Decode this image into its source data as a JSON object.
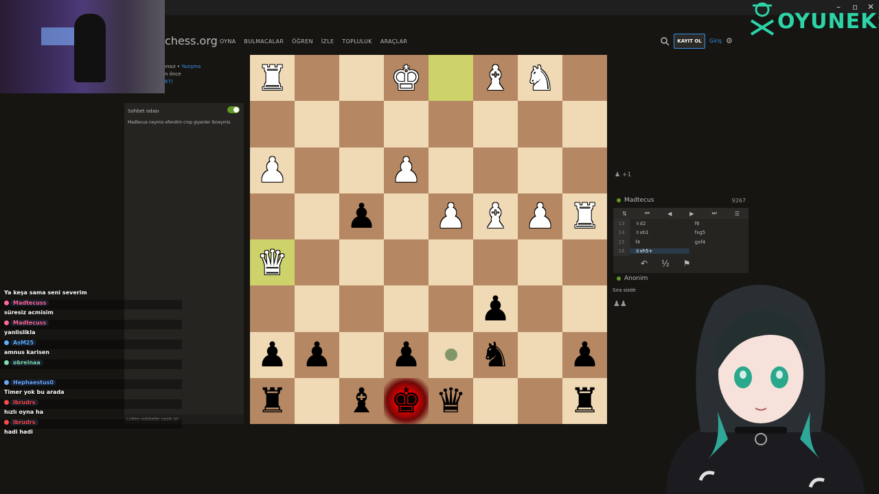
{
  "window": {
    "minimize": "–",
    "maximize": "▫",
    "close": "✕"
  },
  "brand": {
    "text": "OYUNEKS"
  },
  "site": {
    "logo": "chess.org",
    "nav": [
      "OYNA",
      "BULMACALAR",
      "ÖĞREN",
      "İZLE",
      "TOPLULUK",
      "ARAÇLAR"
    ],
    "signup": "KAYIT OL",
    "login": "Giriş"
  },
  "game_info": {
    "line1_prefix": "ınsız • ",
    "line1_link": "Yazışma",
    "line2": "n önce",
    "line3": "67)"
  },
  "chat": {
    "title": "Sohbet odası",
    "message": "Madtecus  neymis efendim crop giyenler ibneymis",
    "placeholder": "Lütfen sohbette nazik ol!"
  },
  "stream_chat": [
    {
      "kind": "text",
      "text": "Ya keşa sama seni severim"
    },
    {
      "kind": "name",
      "text": "Madtecuss",
      "color": "#ff6a9a"
    },
    {
      "kind": "text",
      "text": "süresiz acmisim"
    },
    {
      "kind": "name",
      "text": "Madtecuss",
      "color": "#ff6a9a"
    },
    {
      "kind": "text",
      "text": "yanlislikla"
    },
    {
      "kind": "name",
      "text": "AsM25",
      "color": "#5ab0ff"
    },
    {
      "kind": "text",
      "text": "amnus karisen"
    },
    {
      "kind": "name",
      "text": "obreinaa",
      "color": "#7ee0b0"
    },
    {
      "kind": "text",
      "text": ""
    },
    {
      "kind": "name",
      "text": "Hephaestus0",
      "color": "#6aa8ff"
    },
    {
      "kind": "text",
      "text": "Timer yok bu arada"
    },
    {
      "kind": "name",
      "text": "ibrudrs",
      "color": "#ff4a4a"
    },
    {
      "kind": "text",
      "text": "hızlı oyna ha"
    },
    {
      "kind": "name",
      "text": "ibrudrs",
      "color": "#ff4a4a"
    },
    {
      "kind": "text",
      "text": "hadi hadi"
    }
  ],
  "board": {
    "rows": [
      [
        "wR",
        "",
        "",
        "wK",
        "H",
        "wB",
        "wN",
        ""
      ],
      [
        "",
        "",
        "",
        "",
        "",
        "",
        "",
        ""
      ],
      [
        "wP",
        "",
        "",
        "wP",
        "",
        "",
        "",
        ""
      ],
      [
        "",
        "",
        "bP",
        "",
        "wP",
        "wB",
        "wP",
        "wR"
      ],
      [
        "wQH",
        "",
        "",
        "",
        "",
        "",
        "",
        ""
      ],
      [
        "",
        "",
        "",
        "",
        "",
        "bP",
        "",
        ""
      ],
      [
        "bP",
        "bP",
        "",
        "bP",
        "dot",
        "bN",
        "",
        "bP"
      ],
      [
        "bR",
        "",
        "bB",
        "bKC",
        "bQ",
        "",
        "",
        "bR"
      ]
    ]
  },
  "players": {
    "top": {
      "name": "Madtecus",
      "rating": "9267"
    },
    "bottom": {
      "name": "Anonim"
    }
  },
  "captured_top": "+1",
  "moves": [
    {
      "num": "13",
      "white": "♗d2",
      "black": "f6"
    },
    {
      "num": "14",
      "white": "♗xb1",
      "black": "fxg5"
    },
    {
      "num": "15",
      "white": "f4",
      "black": "gxf4"
    },
    {
      "num": "16",
      "white": "♕xh5+",
      "black": ""
    }
  ],
  "turn_label": "Sıra sizde",
  "actions": {
    "takeback": "↶",
    "draw": "½",
    "resign": "⚑"
  }
}
